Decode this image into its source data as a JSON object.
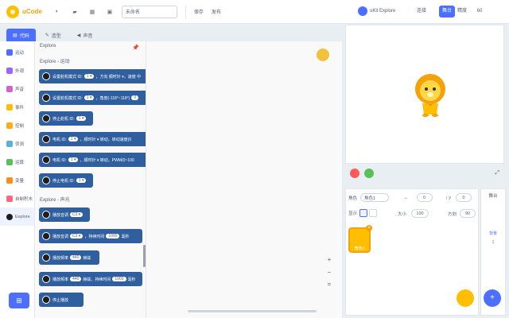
{
  "app": {
    "brand": "uCode",
    "project_name": "未命名"
  },
  "topbar": {
    "save": "保存",
    "publish": "发布",
    "user": "uKit Explore",
    "connect": "连接",
    "stage": "舞台",
    "mode": "精度",
    "zoom": "60"
  },
  "tabs": [
    {
      "label": "代码"
    },
    {
      "label": "造型"
    },
    {
      "label": "声音"
    }
  ],
  "categories": [
    {
      "label": "运动",
      "color": "#4c6fff"
    },
    {
      "label": "外观",
      "color": "#9966ff"
    },
    {
      "label": "声音",
      "color": "#cf63cf"
    },
    {
      "label": "事件",
      "color": "#ffbf00"
    },
    {
      "label": "控制",
      "color": "#ffab19"
    },
    {
      "label": "侦测",
      "color": "#5cb1d6"
    },
    {
      "label": "运算",
      "color": "#59c059"
    },
    {
      "label": "变量",
      "color": "#ff8c1a"
    },
    {
      "label": "自制积木",
      "color": "#ff6680"
    },
    {
      "label": "Explore",
      "color": "#1d1d1d"
    }
  ],
  "palette": {
    "section1": "Explore",
    "section1_sub": "Explore - 运动",
    "section2": "Explore - 声光",
    "blocks": [
      {
        "text": "设置舵机模式 ID:",
        "val": "1 ▾",
        "rest": "，方向 顺时针 ▾，速度 中"
      },
      {
        "text": "设置舵机模式 ID:",
        "val": "1 ▾",
        "rest": "，角度(-118°~118°)",
        "oval": "0"
      },
      {
        "text": "停止舵机 ID:",
        "val": "1 ▾",
        "rest": ""
      },
      {
        "text": "电机 ID:",
        "val": "1 ▾",
        "rest": "，顺时针 ▾ 转动，转动速度(0"
      },
      {
        "text": "电机 ID:",
        "val": "1 ▾",
        "rest": "，顺时针 ▾ 转动，PWM(0~100"
      },
      {
        "text": "停止电机 ID:",
        "val": "1 ▾",
        "rest": ""
      },
      {
        "text": "播放音调",
        "val": "C3 ▾",
        "rest": ""
      },
      {
        "text": "播放音调",
        "val": "C3 ▾",
        "rest": "，持续时间",
        "oval": "1000",
        "tail": "毫秒"
      },
      {
        "text": "播放频率",
        "val": "",
        "rest": "赫兹",
        "oval": "440"
      },
      {
        "text": "播放频率",
        "val": "",
        "rest": "赫兹，持续时间",
        "oval": "440",
        "oval2": "1000",
        "tail": "毫秒"
      },
      {
        "text": "停止播放",
        "val": "",
        "rest": ""
      }
    ]
  },
  "workspace": {
    "zoom_in": "+",
    "zoom_out": "−",
    "reset": "="
  },
  "sprite": {
    "name_label": "角色",
    "name_value": "角色1",
    "x_label": "↔",
    "x_value": "0",
    "y_label": "↕ y",
    "y_value": "0",
    "show_label": "显示",
    "size_label": "大小",
    "size_value": "100",
    "dir_label": "方向",
    "dir_value": "90",
    "thumb_label": "角色1"
  },
  "stage_col": {
    "title": "舞台",
    "bg_label": "背景",
    "bg_count": "1"
  },
  "colors": {
    "accent": "#4c6fff",
    "block": "#2f5f9e"
  }
}
